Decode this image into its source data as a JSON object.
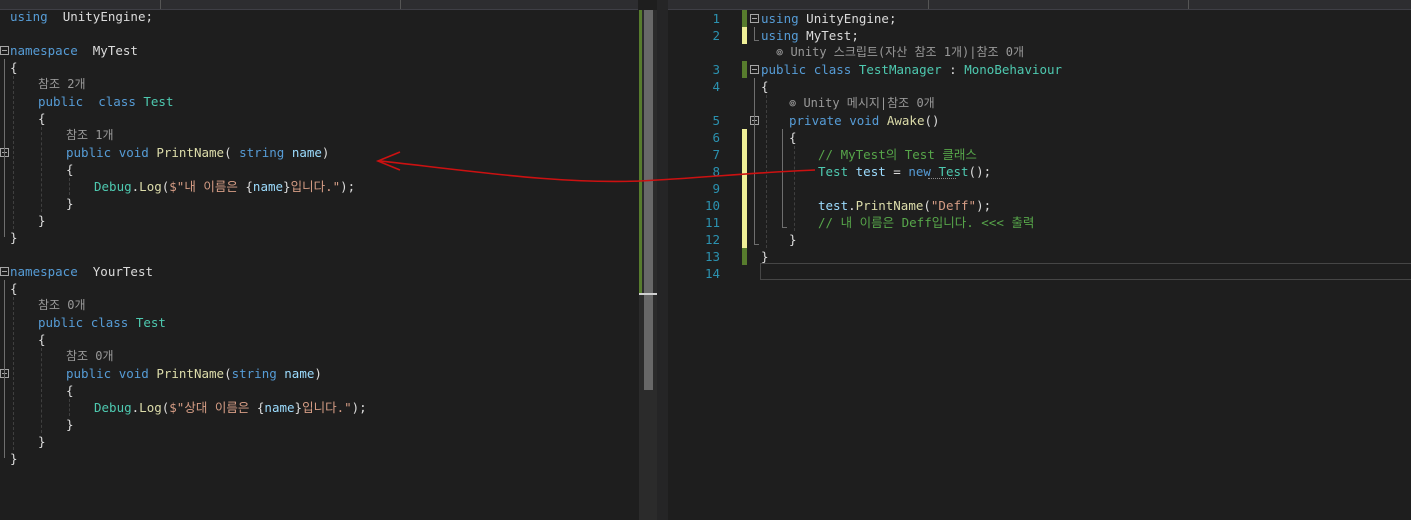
{
  "left_editor": {
    "lines": [
      {
        "n": 0,
        "parts": [
          [
            "kw",
            "using"
          ],
          [
            "",
            "  UnityEngine;"
          ]
        ]
      },
      {
        "n": 1,
        "parts": []
      },
      {
        "n": 2,
        "parts": [
          [
            "kw",
            "namespace"
          ],
          [
            "",
            "  MyTest"
          ]
        ]
      },
      {
        "n": 3,
        "parts": [
          [
            "",
            "{"
          ]
        ]
      },
      {
        "n": 4,
        "lens": "참조 2개"
      },
      {
        "n": 5,
        "parts": [
          [
            "kw",
            "public"
          ],
          [
            "",
            " "
          ],
          [
            "kw",
            " class"
          ],
          [
            "",
            " "
          ],
          [
            "ty",
            "Test"
          ]
        ]
      },
      {
        "n": 6,
        "parts": [
          [
            "",
            "{"
          ]
        ]
      },
      {
        "n": 7,
        "lens": "참조 1개"
      },
      {
        "n": 8,
        "parts": [
          [
            "kw",
            "public"
          ],
          [
            "",
            " "
          ],
          [
            "kw",
            "void"
          ],
          [
            "",
            " "
          ],
          [
            "fn",
            "PrintName"
          ],
          [
            "",
            "( "
          ],
          [
            "kw",
            "string"
          ],
          [
            "",
            " "
          ],
          [
            "par",
            "name"
          ],
          [
            "",
            ")"
          ]
        ]
      },
      {
        "n": 9,
        "parts": [
          [
            "",
            "{"
          ]
        ]
      },
      {
        "n": 10,
        "parts": [
          [
            "ty",
            "Debug"
          ],
          [
            "",
            "."
          ],
          [
            "fn",
            "Log"
          ],
          [
            "",
            "("
          ],
          [
            "str",
            "$\"내 이름은 "
          ],
          [
            "",
            "{"
          ],
          [
            "par",
            "name"
          ],
          [
            "",
            "}"
          ],
          [
            "str",
            "입니다.\""
          ],
          [
            "",
            ");"
          ]
        ]
      },
      {
        "n": 11,
        "parts": [
          [
            "",
            "}"
          ]
        ]
      },
      {
        "n": 12,
        "parts": [
          [
            "",
            "}"
          ]
        ]
      },
      {
        "n": 13,
        "parts": [
          [
            "",
            "}"
          ]
        ]
      },
      {
        "n": 14,
        "parts": []
      },
      {
        "n": 15,
        "parts": [
          [
            "kw",
            "namespace"
          ],
          [
            "",
            "  YourTest"
          ]
        ]
      },
      {
        "n": 16,
        "parts": [
          [
            "",
            "{"
          ]
        ]
      },
      {
        "n": 17,
        "lens": "참조 0개"
      },
      {
        "n": 18,
        "parts": [
          [
            "kw",
            "public"
          ],
          [
            "",
            " "
          ],
          [
            "kw",
            "class"
          ],
          [
            "",
            " "
          ],
          [
            "ty",
            "Test"
          ]
        ]
      },
      {
        "n": 19,
        "parts": [
          [
            "",
            "{"
          ]
        ]
      },
      {
        "n": 20,
        "lens": "참조 0개"
      },
      {
        "n": 21,
        "parts": [
          [
            "kw",
            "public"
          ],
          [
            "",
            " "
          ],
          [
            "kw",
            "void"
          ],
          [
            "",
            " "
          ],
          [
            "fn",
            "PrintName"
          ],
          [
            "",
            "("
          ],
          [
            "kw",
            "string"
          ],
          [
            "",
            " "
          ],
          [
            "par",
            "name"
          ],
          [
            "",
            ")"
          ]
        ]
      },
      {
        "n": 22,
        "parts": [
          [
            "",
            "{"
          ]
        ]
      },
      {
        "n": 23,
        "parts": [
          [
            "ty",
            "Debug"
          ],
          [
            "",
            "."
          ],
          [
            "fn",
            "Log"
          ],
          [
            "",
            "("
          ],
          [
            "str",
            "$\"상대 이름은 "
          ],
          [
            "",
            "{"
          ],
          [
            "par",
            "name"
          ],
          [
            "",
            "}"
          ],
          [
            "str",
            "입니다.\""
          ],
          [
            "",
            ");"
          ]
        ]
      },
      {
        "n": 24,
        "parts": [
          [
            "",
            "}"
          ]
        ]
      },
      {
        "n": 25,
        "parts": [
          [
            "",
            "}"
          ]
        ]
      },
      {
        "n": 26,
        "parts": [
          [
            "",
            "}"
          ]
        ]
      }
    ]
  },
  "right_editor": {
    "lines": [
      {
        "num": "1",
        "parts": [
          [
            "kw",
            "using"
          ],
          [
            "",
            " UnityEngine;"
          ]
        ]
      },
      {
        "num": "2",
        "parts": [
          [
            "kw",
            "using"
          ],
          [
            "",
            " MyTest;"
          ]
        ]
      },
      {
        "num": "",
        "lens": "⊚ Unity 스크립트(자산 참조 1개)|참조 0개"
      },
      {
        "num": "3",
        "parts": [
          [
            "kw",
            "public"
          ],
          [
            "",
            " "
          ],
          [
            "kw",
            "class"
          ],
          [
            "",
            " "
          ],
          [
            "ty",
            "TestManager"
          ],
          [
            "",
            " : "
          ],
          [
            "ty",
            "MonoBehaviour"
          ]
        ]
      },
      {
        "num": "4",
        "parts": [
          [
            "",
            "{"
          ]
        ]
      },
      {
        "num": "",
        "lens": "⊚ Unity 메시지|참조 0개"
      },
      {
        "num": "5",
        "parts": [
          [
            "kw",
            "private"
          ],
          [
            "",
            " "
          ],
          [
            "kw",
            "void"
          ],
          [
            "",
            " "
          ],
          [
            "fn",
            "Awake"
          ],
          [
            "",
            "()"
          ]
        ]
      },
      {
        "num": "6",
        "parts": [
          [
            "",
            "{"
          ]
        ]
      },
      {
        "num": "7",
        "parts": [
          [
            "cm",
            "// MyTest의 Test 클래스"
          ]
        ]
      },
      {
        "num": "8",
        "parts": [
          [
            "ty",
            "Test"
          ],
          [
            "",
            " "
          ],
          [
            "par",
            "test"
          ],
          [
            "",
            " = "
          ],
          [
            "kw",
            "new"
          ],
          [
            "",
            " "
          ],
          [
            "ty",
            "Test"
          ],
          [
            "",
            "();"
          ]
        ]
      },
      {
        "num": "9",
        "parts": []
      },
      {
        "num": "10",
        "parts": [
          [
            "par",
            "test"
          ],
          [
            "",
            "."
          ],
          [
            "fn",
            "PrintName"
          ],
          [
            "",
            "("
          ],
          [
            "str",
            "\"Deff\""
          ],
          [
            "",
            ");"
          ]
        ]
      },
      {
        "num": "11",
        "parts": [
          [
            "cm",
            "// 내 이름은 Deff입니다. <<< 출력"
          ]
        ]
      },
      {
        "num": "12",
        "parts": [
          [
            "",
            "}"
          ]
        ]
      },
      {
        "num": "13",
        "parts": [
          [
            "",
            "}"
          ]
        ]
      },
      {
        "num": "14",
        "parts": []
      }
    ]
  },
  "colors": {
    "keyword": "#569cd6",
    "type": "#4ec9b0",
    "method": "#dcdcaa",
    "identifier": "#9cdcfe",
    "string": "#d69d85",
    "comment": "#57a64a",
    "line_number": "#2b91af",
    "annotation_arrow": "#cc1111"
  }
}
